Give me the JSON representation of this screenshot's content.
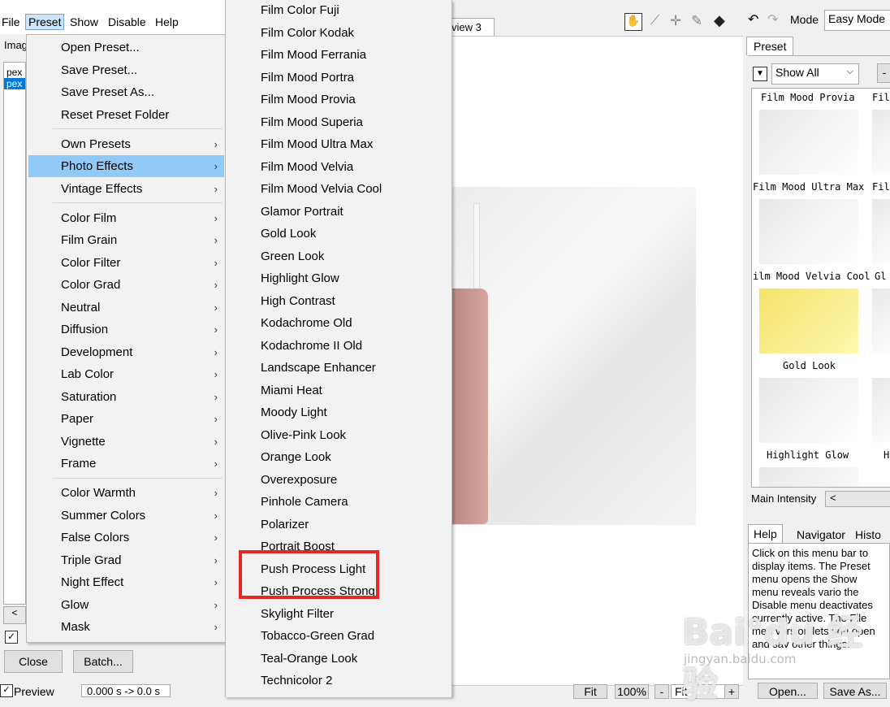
{
  "menubar": {
    "file": "File",
    "preset": "Preset",
    "show": "Show",
    "disable": "Disable",
    "help": "Help"
  },
  "left_panel": {
    "label": "Imag",
    "list_items": [
      "pex",
      "pex"
    ],
    "close_btn": "Close",
    "batch_btn": "Batch...",
    "preview": "Preview",
    "timing": "0.000 s -> 0.0 s"
  },
  "preset_menu": [
    {
      "label": "Open Preset...",
      "submenu": false
    },
    {
      "label": "Save Preset...",
      "submenu": false
    },
    {
      "label": "Save Preset As...",
      "submenu": false
    },
    {
      "label": "Reset Preset Folder",
      "submenu": false
    },
    {
      "label": "Own Presets",
      "submenu": true
    },
    {
      "label": "Photo Effects",
      "submenu": true,
      "highlighted": true
    },
    {
      "label": "Vintage Effects",
      "submenu": true
    },
    {
      "label": "Color Film",
      "submenu": true
    },
    {
      "label": "Film Grain",
      "submenu": true
    },
    {
      "label": "Color Filter",
      "submenu": true
    },
    {
      "label": "Color Grad",
      "submenu": true
    },
    {
      "label": "Neutral",
      "submenu": true
    },
    {
      "label": "Diffusion",
      "submenu": true
    },
    {
      "label": "Development",
      "submenu": true
    },
    {
      "label": "Lab Color",
      "submenu": true
    },
    {
      "label": "Saturation",
      "submenu": true
    },
    {
      "label": "Paper",
      "submenu": true
    },
    {
      "label": "Vignette",
      "submenu": true
    },
    {
      "label": "Frame",
      "submenu": true
    },
    {
      "label": "Color Warmth",
      "submenu": true
    },
    {
      "label": "Summer Colors",
      "submenu": true
    },
    {
      "label": "False Colors",
      "submenu": true
    },
    {
      "label": "Triple Grad",
      "submenu": true
    },
    {
      "label": "Night Effect",
      "submenu": true
    },
    {
      "label": "Glow",
      "submenu": true
    },
    {
      "label": "Mask",
      "submenu": true
    }
  ],
  "photo_effects_submenu": [
    "Film Color Fuji",
    "Film Color Kodak",
    "Film Mood Ferrania",
    "Film Mood Portra",
    "Film Mood Provia",
    "Film Mood Superia",
    "Film Mood Ultra Max",
    "Film Mood Velvia",
    "Film Mood Velvia Cool",
    "Glamor Portrait",
    "Gold Look",
    "Green Look",
    "Highlight Glow",
    "High Contrast",
    "Kodachrome Old",
    "Kodachrome II Old",
    "Landscape Enhancer",
    "Miami Heat",
    "Moody Light",
    "Olive-Pink Look",
    "Orange Look",
    "Overexposure",
    "Pinhole Camera",
    "Polarizer",
    "Portrait Boost",
    "Push Process Light",
    "Push Process Strong",
    "Skylight Filter",
    "Tobacco-Green Grad",
    "Teal-Orange Look",
    "Technicolor 2"
  ],
  "center": {
    "tab": "view 3",
    "fit": "Fit",
    "zoom": "100%",
    "minus": "-",
    "fit_select": "Fit",
    "plus": "+"
  },
  "toolbar": {
    "mode_label": "Mode",
    "mode_value": "Easy Mode"
  },
  "right_panel": {
    "preset_tab": "Preset",
    "show_all": "Show All",
    "thumbs": [
      {
        "caption": "Film Mood Provia",
        "cap2": "Fil"
      },
      {
        "caption": "Film Mood Ultra Max",
        "cap2": "Fil"
      },
      {
        "caption": "ilm Mood Velvia Cool",
        "cap2": "Gl"
      },
      {
        "caption": "Gold Look",
        "cap2": ""
      },
      {
        "caption": "Highlight Glow",
        "cap2": "H"
      }
    ],
    "main_intensity": "Main Intensity",
    "help_tabs": [
      "Help",
      "Navigator",
      "Histo"
    ],
    "help_text": "Click on this menu bar to display items. The Preset menu opens the Show menu reveals vario the Disable menu deactivates currently active. The File men version lets you open and sav other things.",
    "open_btn": "Open...",
    "save_btn": "Save As..."
  },
  "watermark": {
    "main": "Bai°du 经验",
    "sub": "jingyan.baidu.com"
  },
  "colors": {
    "highlight": "#91c9f7",
    "annotation_box": "#e32a2a"
  }
}
